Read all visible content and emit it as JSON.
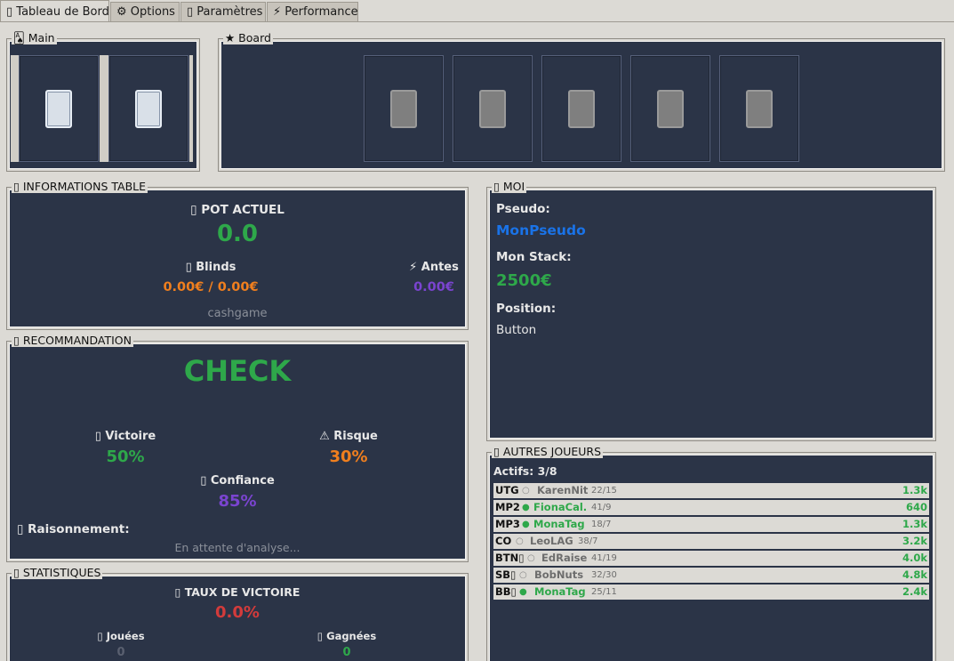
{
  "tabs": [
    {
      "icon": "▯",
      "label": "Tableau de Bord"
    },
    {
      "icon": "⚙",
      "label": "Options"
    },
    {
      "icon": "▯",
      "label": "Paramètres"
    },
    {
      "icon": "⚡",
      "label": "Performance"
    }
  ],
  "sections": {
    "main": "🂡 Main",
    "board": "★ Board",
    "table_info": "▯ INFORMATIONS TABLE",
    "me": "▯ MOI",
    "recommendation": "▯ RECOMMANDATION",
    "others": "▯ AUTRES JOUEURS",
    "stats": "▯ STATISTIQUES"
  },
  "table_info": {
    "pot_label": "▯ POT ACTUEL",
    "pot_value": "0.0",
    "blinds_label": "▯ Blinds",
    "blinds_value": "0.00€ / 0.00€",
    "antes_label": "⚡ Antes",
    "antes_value": "0.00€",
    "game_type": "cashgame"
  },
  "me": {
    "pseudo_label": "Pseudo:",
    "pseudo_value": "MonPseudo",
    "stack_label": "Mon Stack:",
    "stack_value": "2500€",
    "position_label": "Position:",
    "position_value": "Button"
  },
  "recommendation": {
    "action": "CHECK",
    "victory_label": "▯ Victoire",
    "victory_value": "50%",
    "risk_label": "⚠ Risque",
    "risk_value": "30%",
    "confidence_label": "▯ Confiance",
    "confidence_value": "85%",
    "reasoning_label": "▯ Raisonnement:",
    "reasoning_value": "En attente d'analyse..."
  },
  "others": {
    "active_label": "Actifs:",
    "active_value": "3/8",
    "players": [
      {
        "pos": "UTG",
        "dot": "○",
        "active": false,
        "name": "KarenNit",
        "vpip": "22/15",
        "stack": "1.3k"
      },
      {
        "pos": "MP2",
        "dot": "●",
        "active": true,
        "name": "FionaCal.",
        "vpip": "41/9",
        "stack": "640"
      },
      {
        "pos": "MP3",
        "dot": "●",
        "active": true,
        "name": "MonaTag",
        "vpip": "18/7",
        "stack": "1.3k"
      },
      {
        "pos": "CO",
        "dot": "○",
        "active": false,
        "name": "LeoLAG",
        "vpip": "38/7",
        "stack": "3.2k"
      },
      {
        "pos": "BTN▯",
        "dot": "○",
        "active": false,
        "name": "EdRaise",
        "vpip": "41/19",
        "stack": "4.0k"
      },
      {
        "pos": "SB▯",
        "dot": "○",
        "active": false,
        "name": "BobNuts",
        "vpip": "32/30",
        "stack": "4.8k"
      },
      {
        "pos": "BB▯",
        "dot": "●",
        "active": true,
        "name": "MonaTag",
        "vpip": "25/11",
        "stack": "2.4k"
      }
    ]
  },
  "stats": {
    "win_rate_label": "▯ TAUX DE VICTOIRE",
    "win_rate_value": "0.0%",
    "played_label": "▯ Jouées",
    "played_value": "0",
    "won_label": "▯ Gagnées",
    "won_value": "0"
  },
  "colors": {
    "panel": "#2b3447",
    "green": "#2ea84a",
    "orange": "#f07f1e",
    "purple": "#7a44d0",
    "red": "#d33b3b",
    "blue": "#1a73e8"
  }
}
